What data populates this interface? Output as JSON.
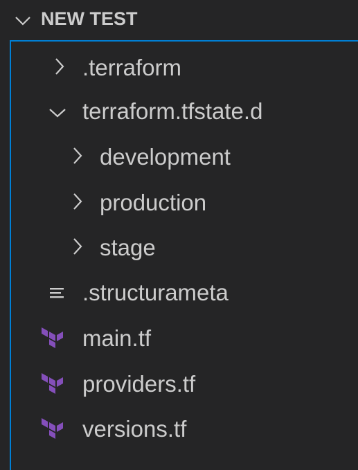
{
  "explorer": {
    "section_title": "NEW TEST",
    "accent_color": "#007fd4",
    "background_color": "#252526",
    "items": [
      {
        "label": ".terraform",
        "kind": "folder",
        "expanded": false,
        "depth": 1,
        "icon": "chevron-right-icon"
      },
      {
        "label": "terraform.tfstate.d",
        "kind": "folder",
        "expanded": true,
        "depth": 1,
        "icon": "chevron-down-icon"
      },
      {
        "label": "development",
        "kind": "folder",
        "expanded": false,
        "depth": 2,
        "icon": "chevron-right-icon"
      },
      {
        "label": "production",
        "kind": "folder",
        "expanded": false,
        "depth": 2,
        "icon": "chevron-right-icon"
      },
      {
        "label": "stage",
        "kind": "folder",
        "expanded": false,
        "depth": 2,
        "icon": "chevron-right-icon"
      },
      {
        "label": ".structurameta",
        "kind": "file",
        "depth": 1,
        "icon": "text-file-icon"
      },
      {
        "label": "main.tf",
        "kind": "file",
        "depth": 1,
        "icon": "terraform-icon"
      },
      {
        "label": "providers.tf",
        "kind": "file",
        "depth": 1,
        "icon": "terraform-icon"
      },
      {
        "label": "versions.tf",
        "kind": "file",
        "depth": 1,
        "icon": "terraform-icon"
      }
    ],
    "terraform_icon_color": "#844fba"
  }
}
